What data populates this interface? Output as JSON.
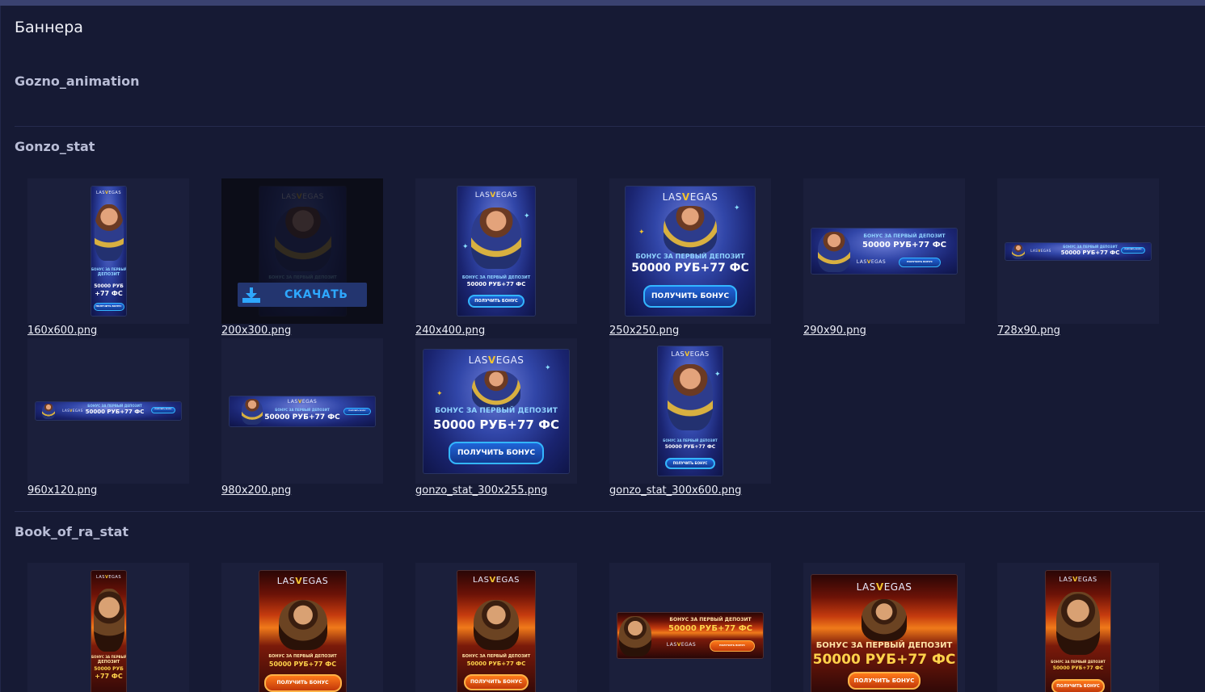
{
  "page": {
    "title": "Баннера"
  },
  "sections": [
    {
      "title": "Gozno_animation",
      "items": []
    },
    {
      "title": "Gonzo_stat",
      "items": [
        {
          "file": "160x600.png"
        },
        {
          "file": "200x300.png",
          "action": "СКАЧАТЬ"
        },
        {
          "file": "240x400.png"
        },
        {
          "file": "250x250.png"
        },
        {
          "file": "290x90.png"
        },
        {
          "file": "728x90.png"
        },
        {
          "file": "960x120.png"
        },
        {
          "file": "980x200.png"
        },
        {
          "file": "gonzo_stat_300x255.png"
        },
        {
          "file": "gonzo_stat_300x600.png"
        }
      ]
    },
    {
      "title": "Book_of_ra_stat",
      "items": []
    }
  ],
  "banner": {
    "logo_left": "LAS",
    "logo_v": "V",
    "logo_right": "EGAS",
    "headline": "БОНУС ЗА ПЕРВЫЙ ДЕПОЗИТ",
    "headline_short_1": "БОНУС ЗА ПЕРВЫЙ",
    "headline_short_2": "ДЕПОЗИТ",
    "offer": "50000 РУБ+77 ФС",
    "offer_1": "50000 РУБ",
    "offer_2": "+77 ФС",
    "cta": "ПОЛУЧИТЬ БОНУС"
  },
  "colors": {
    "background": "#161a34",
    "tile": "#1b1f3b",
    "accent": "#2ea8ff",
    "logo_v": "#f2c32e"
  },
  "icons": {
    "download": "download-icon"
  }
}
